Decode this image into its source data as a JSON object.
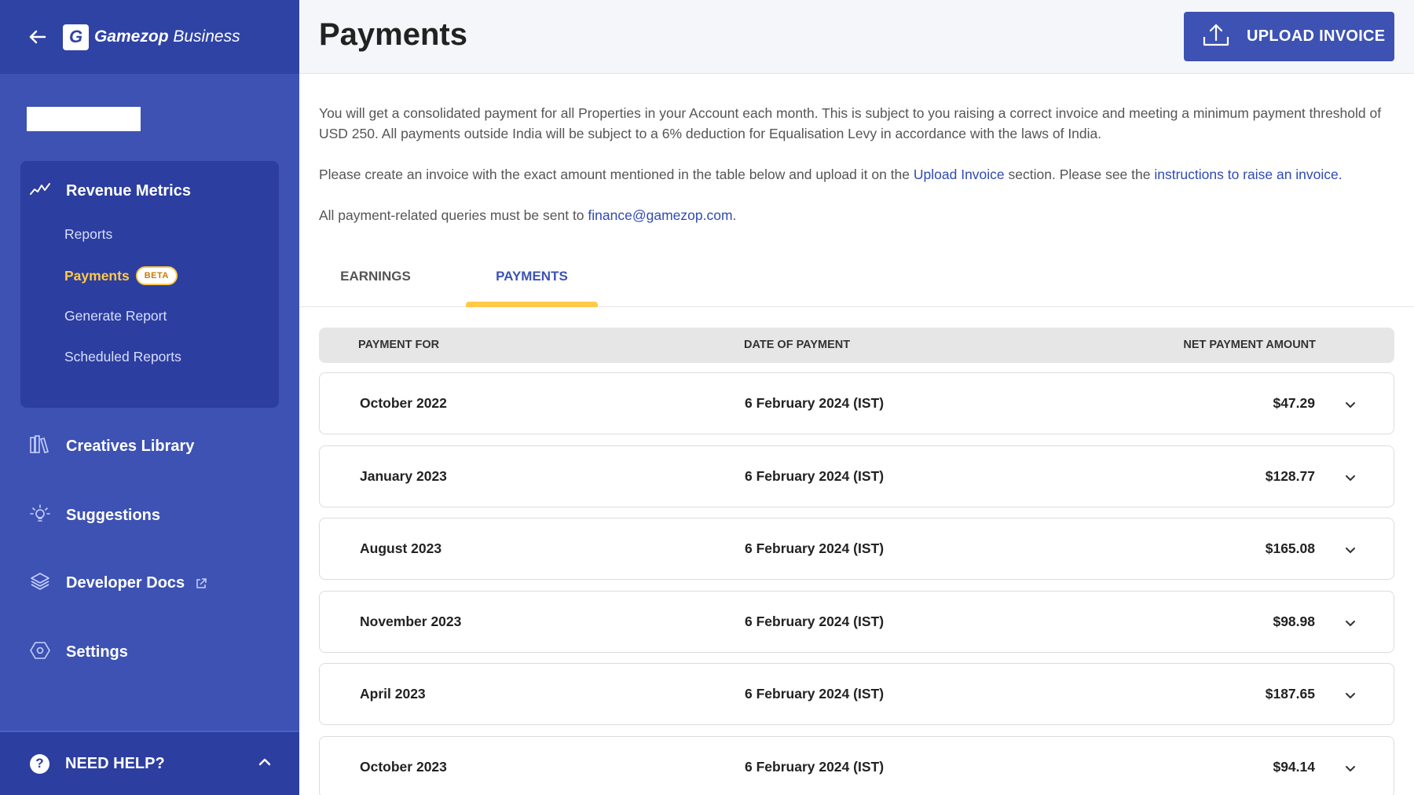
{
  "sidebar": {
    "logo_letter": "G",
    "logo_brand": "Gamezop",
    "logo_suffix": "Business",
    "revenue_metrics": {
      "label": "Revenue Metrics",
      "items": [
        {
          "label": "Reports"
        },
        {
          "label": "Payments",
          "badge": "BETA"
        },
        {
          "label": "Generate Report"
        },
        {
          "label": "Scheduled Reports"
        }
      ]
    },
    "nav": [
      {
        "label": "Creatives Library",
        "icon": "books-icon"
      },
      {
        "label": "Suggestions",
        "icon": "lightbulb-icon"
      },
      {
        "label": "Developer Docs",
        "icon": "layers-icon"
      },
      {
        "label": "Settings",
        "icon": "hexagon-gear-icon"
      }
    ],
    "help": {
      "label": "NEED HELP?"
    }
  },
  "header": {
    "title": "Payments",
    "upload_label": "UPLOAD INVOICE"
  },
  "info": {
    "p1": "You will get a consolidated payment for all Properties in your Account each month. This is subject to you raising a correct invoice and meeting a minimum payment threshold of USD 250. All payments outside India will be subject to a 6% deduction for Equalisation Levy in accordance with the laws of India.",
    "p2_before": "Please create an invoice with the exact amount mentioned in the table below and upload it on the ",
    "p2_link1": "Upload Invoice",
    "p2_middle": " section. Please see the ",
    "p2_link2": "instructions to raise an invoice.",
    "p3_before": "All payment-related queries must be sent to ",
    "p3_email": "finance@gamezop.com",
    "p3_after": "."
  },
  "tabs": [
    {
      "label": "EARNINGS",
      "active": false
    },
    {
      "label": "PAYMENTS",
      "active": true
    }
  ],
  "table": {
    "columns": [
      "PAYMENT FOR",
      "DATE OF PAYMENT",
      "NET PAYMENT AMOUNT"
    ],
    "rows": [
      {
        "for": "October 2022",
        "date": "6 February 2024 (IST)",
        "amount": "$47.29"
      },
      {
        "for": "January 2023",
        "date": "6 February 2024 (IST)",
        "amount": "$128.77"
      },
      {
        "for": "August 2023",
        "date": "6 February 2024 (IST)",
        "amount": "$165.08"
      },
      {
        "for": "November 2023",
        "date": "6 February 2024 (IST)",
        "amount": "$98.98"
      },
      {
        "for": "April 2023",
        "date": "6 February 2024 (IST)",
        "amount": "$187.65"
      },
      {
        "for": "October 2023",
        "date": "6 February 2024 (IST)",
        "amount": "$94.14"
      }
    ]
  },
  "colors": {
    "sidebar": "#3d52b3",
    "sidebar_dark": "#2c3e9f",
    "accent_yellow": "#ffc94a",
    "link": "#2f4bb3"
  }
}
